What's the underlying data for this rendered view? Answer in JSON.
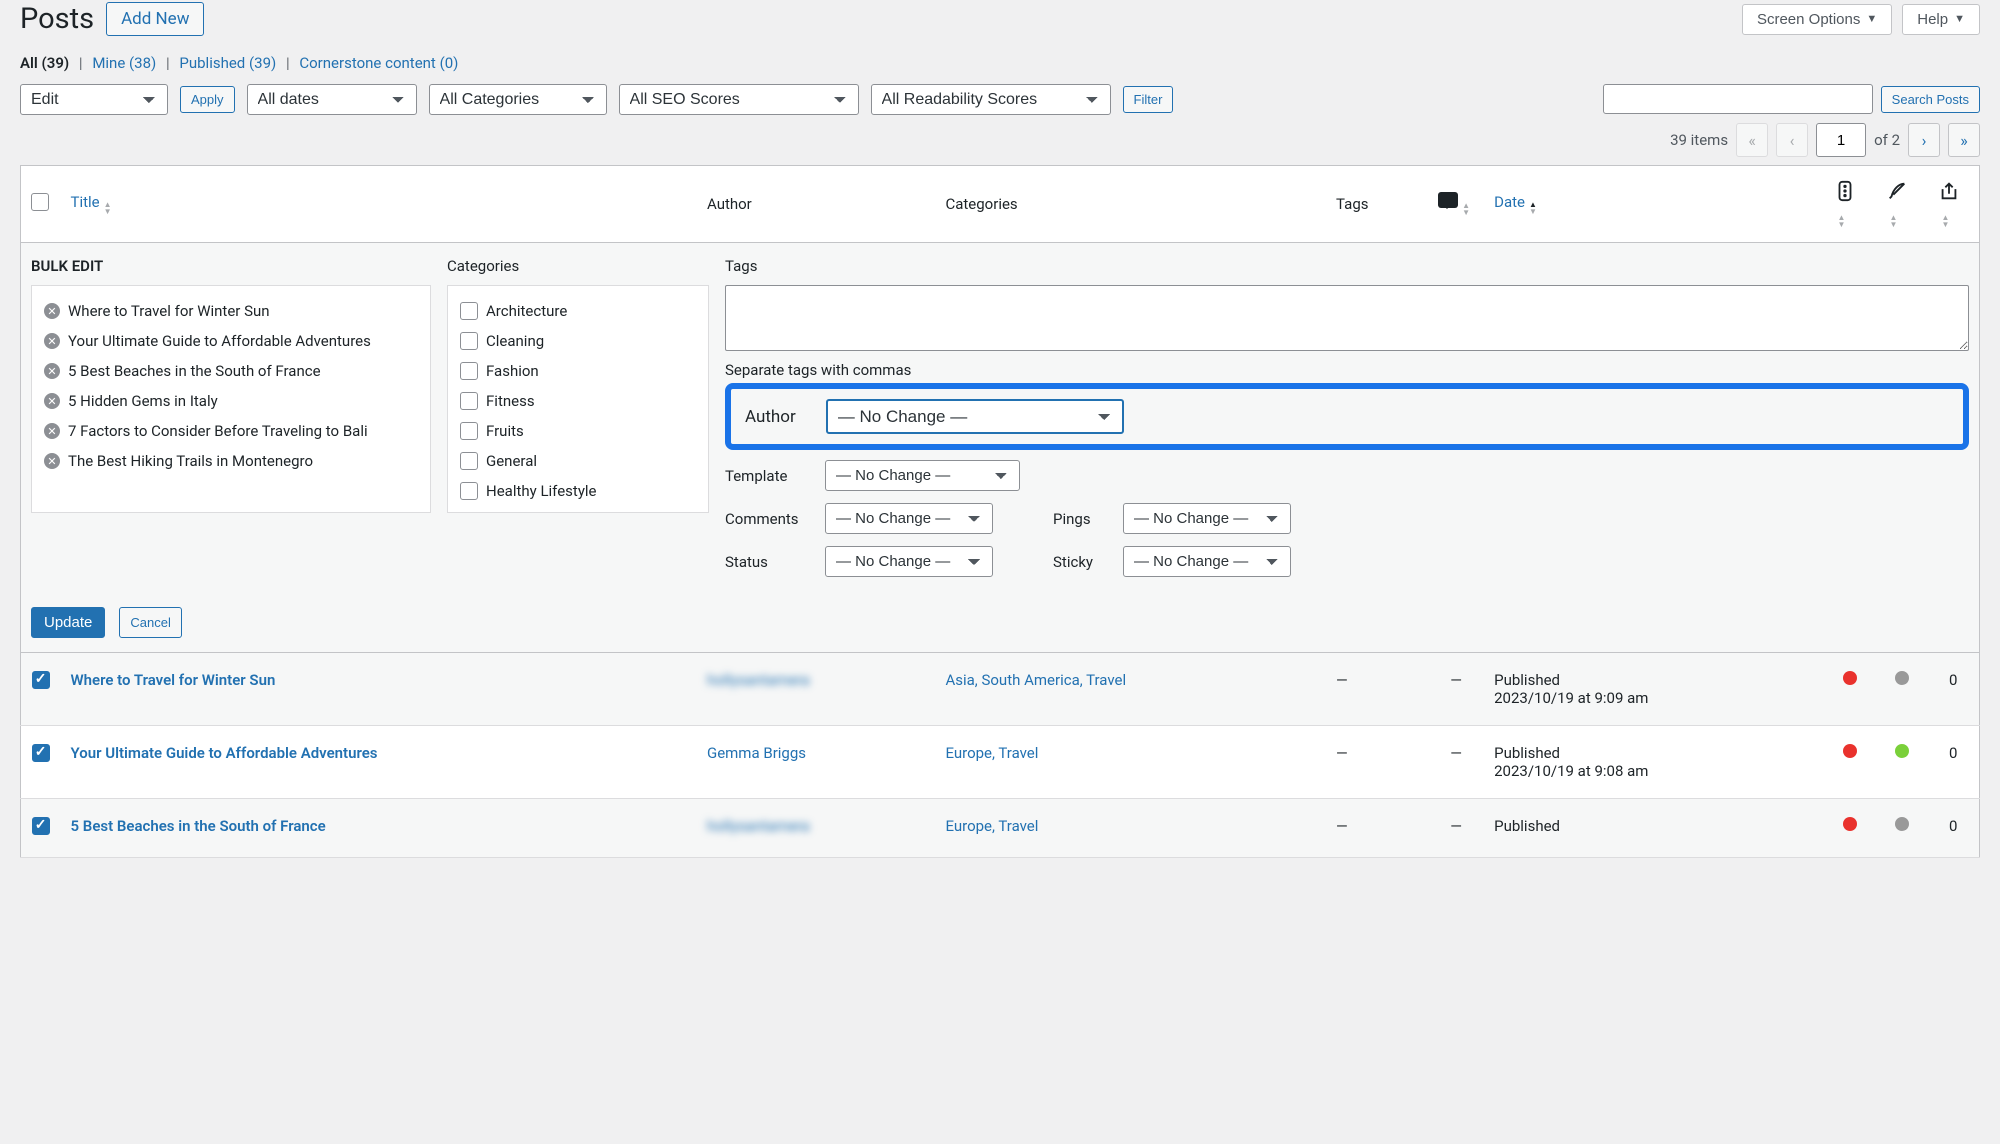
{
  "page": {
    "title": "Posts",
    "add_new": "Add New",
    "screen_options": "Screen Options",
    "help": "Help"
  },
  "subsubsub": {
    "all_label": "All",
    "all_count": "(39)",
    "mine_label": "Mine",
    "mine_count": "(38)",
    "published_label": "Published",
    "published_count": "(39)",
    "cornerstone_label": "Cornerstone content",
    "cornerstone_count": "(0)"
  },
  "filters": {
    "bulk_action": "Edit",
    "apply": "Apply",
    "dates": "All dates",
    "categories": "All Categories",
    "seo": "All SEO Scores",
    "readability": "All Readability Scores",
    "filter_btn": "Filter",
    "search_btn": "Search Posts"
  },
  "pagination": {
    "items_text": "39 items",
    "current": "1",
    "total_text": "of 2"
  },
  "table_headers": {
    "title": "Title",
    "author": "Author",
    "categories": "Categories",
    "tags": "Tags",
    "date": "Date"
  },
  "bulk_edit": {
    "heading": "BULK EDIT",
    "categories_label": "Categories",
    "tags_label": "Tags",
    "tags_hint": "Separate tags with commas",
    "author_label": "Author",
    "template_label": "Template",
    "comments_label": "Comments",
    "pings_label": "Pings",
    "status_label": "Status",
    "sticky_label": "Sticky",
    "no_change": "— No Change —",
    "update": "Update",
    "cancel": "Cancel",
    "posts": [
      "Where to Travel for Winter Sun",
      "Your Ultimate Guide to Affordable Adventures",
      "5 Best Beaches in the South of France",
      "5 Hidden Gems in Italy",
      "7 Factors to Consider Before Traveling to Bali",
      "The Best Hiking Trails in Montenegro"
    ],
    "categories": [
      "Architecture",
      "Cleaning",
      "Fashion",
      "Fitness",
      "Fruits",
      "General",
      "Healthy Lifestyle"
    ]
  },
  "posts": [
    {
      "title": "Where to Travel for Winter Sun",
      "author": "hollysantamera",
      "author_blur": true,
      "categories": "Asia, South America, Travel",
      "tags": "—",
      "comments": "—",
      "status": "Published",
      "date": "2023/10/19 at 9:09 am",
      "seo_dot": "red",
      "read_dot": "gray",
      "links": "0"
    },
    {
      "title": "Your Ultimate Guide to Affordable Adventures",
      "author": "Gemma Briggs",
      "author_blur": false,
      "categories": "Europe, Travel",
      "tags": "—",
      "comments": "—",
      "status": "Published",
      "date": "2023/10/19 at 9:08 am",
      "seo_dot": "red",
      "read_dot": "green",
      "links": "0"
    },
    {
      "title": "5 Best Beaches in the South of France",
      "author": "hollysantamera",
      "author_blur": true,
      "categories": "Europe, Travel",
      "tags": "—",
      "comments": "—",
      "status": "Published",
      "date": "",
      "seo_dot": "red",
      "read_dot": "gray",
      "links": "0"
    }
  ]
}
